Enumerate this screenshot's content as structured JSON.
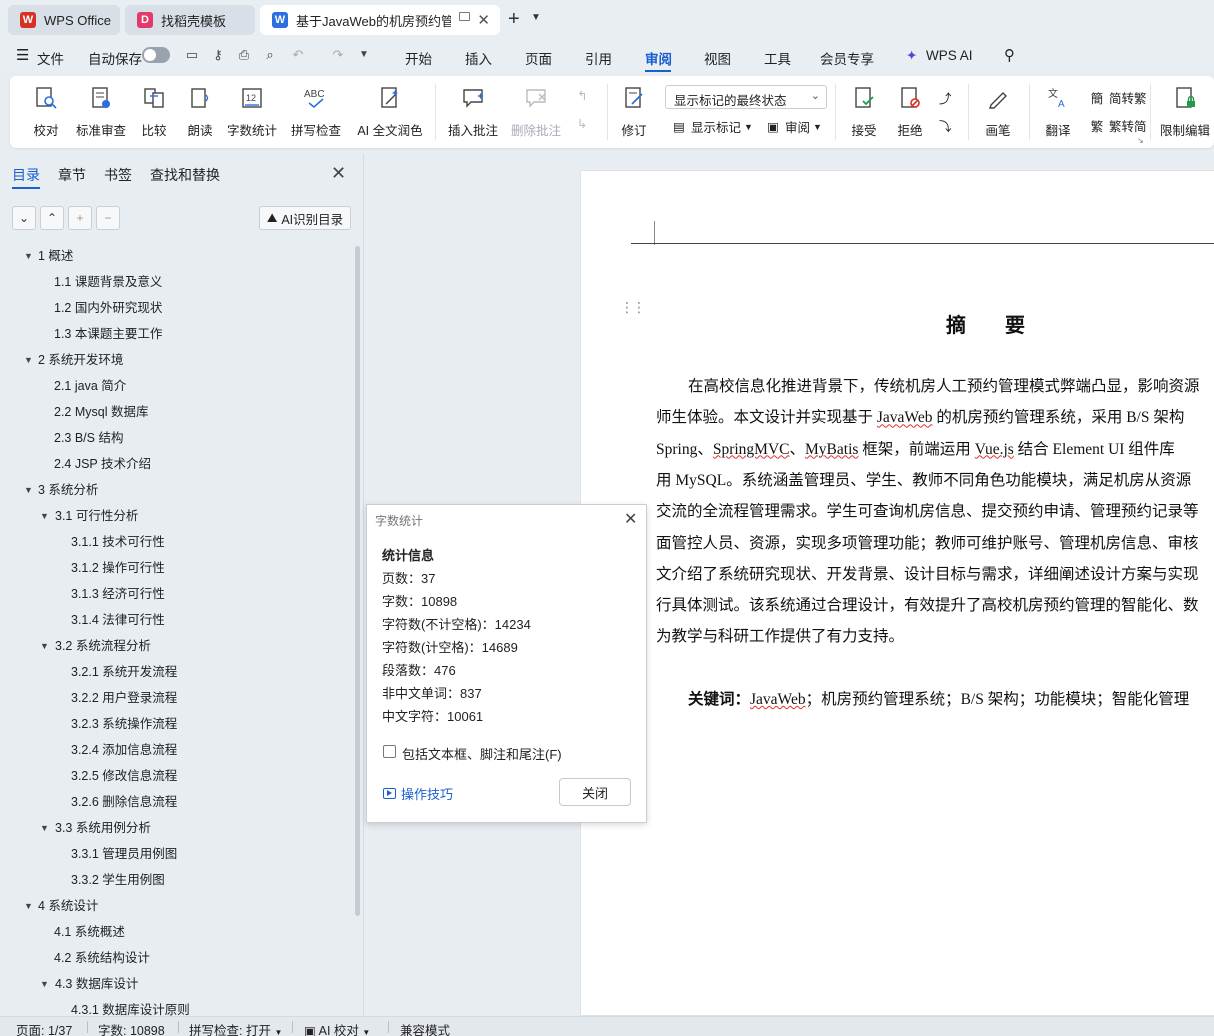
{
  "tabs": [
    {
      "label": "WPS Office",
      "icon": "wps-logo-icon"
    },
    {
      "label": "找稻壳模板",
      "icon": "docer-icon"
    },
    {
      "label": "基于JavaWeb的机房预约管理",
      "icon": "word-doc-icon"
    }
  ],
  "menubar": {
    "file": "文件",
    "autosave": "自动保存",
    "items": [
      "开始",
      "插入",
      "页面",
      "引用",
      "审阅",
      "视图",
      "工具",
      "会员专享"
    ],
    "active": "审阅",
    "wps_ai": "WPS AI"
  },
  "ribbon": {
    "proofread": "校对",
    "std_review": "标准审查",
    "compare": "比较",
    "read_aloud": "朗读",
    "word_count": "字数统计",
    "spell_check": "拼写检查",
    "ai_polish": "AI 全文润色",
    "insert_comment": "插入批注",
    "delete_comment": "删除批注",
    "track_changes": "修订",
    "show_markup_select": "显示标记的最终状态",
    "show_markup": "显示标记",
    "review": "审阅",
    "accept": "接受",
    "reject": "拒绝",
    "pen": "画笔",
    "translate": "翻译",
    "to_traditional": "简转繁",
    "to_simplified": "繁转简",
    "restrict_edit": "限制编辑"
  },
  "nav": {
    "tabs": [
      "目录",
      "章节",
      "书签",
      "查找和替换"
    ],
    "ai_button": "AI识别目录",
    "toc": [
      {
        "label": "1  概述",
        "level": 1,
        "expanded": true
      },
      {
        "label": "1.1 课题背景及意义",
        "level": 2
      },
      {
        "label": "1.2  国内外研究现状",
        "level": 2
      },
      {
        "label": "1.3  本课题主要工作",
        "level": 2
      },
      {
        "label": "2  系统开发环境",
        "level": 1,
        "expanded": true
      },
      {
        "label": "2.1 java 简介",
        "level": 2
      },
      {
        "label": "2.2 Mysql 数据库",
        "level": 2
      },
      {
        "label": "2.3 B/S 结构",
        "level": 2
      },
      {
        "label": "2.4 JSP 技术介绍",
        "level": 2
      },
      {
        "label": "3  系统分析",
        "level": 1,
        "expanded": true
      },
      {
        "label": "3.1  可行性分析",
        "level": 2,
        "expanded": true
      },
      {
        "label": "3.1.1  技术可行性",
        "level": 3
      },
      {
        "label": "3.1.2 操作可行性",
        "level": 3
      },
      {
        "label": "3.1.3  经济可行性",
        "level": 3
      },
      {
        "label": "3.1.4  法律可行性",
        "level": 3
      },
      {
        "label": "3.2 系统流程分析",
        "level": 2,
        "expanded": true
      },
      {
        "label": "3.2.1 系统开发流程",
        "level": 3
      },
      {
        "label": "3.2.2  用户登录流程",
        "level": 3
      },
      {
        "label": "3.2.3  系统操作流程",
        "level": 3
      },
      {
        "label": "3.2.4  添加信息流程",
        "level": 3
      },
      {
        "label": "3.2.5  修改信息流程",
        "level": 3
      },
      {
        "label": "3.2.6  删除信息流程",
        "level": 3
      },
      {
        "label": "3.3 系统用例分析",
        "level": 2,
        "expanded": true
      },
      {
        "label": "3.3.1 管理员用例图",
        "level": 3
      },
      {
        "label": "3.3.2 学生用例图",
        "level": 3
      },
      {
        "label": "4  系统设计",
        "level": 1,
        "expanded": true
      },
      {
        "label": "4.1  系统概述",
        "level": 2
      },
      {
        "label": "4.2  系统结构设计",
        "level": 2
      },
      {
        "label": "4.3 数据库设计",
        "level": 2,
        "expanded": true
      },
      {
        "label": "4.3.1  数据库设计原则",
        "level": 3
      }
    ]
  },
  "document": {
    "title": "摘 要",
    "lines": [
      "在高校信息化推进背景下，传统机房人工预约管理模式弊端凸显，影响资源",
      "师生体验。本文设计并实现基于 JavaWeb 的机房预约管理系统，采用 B/S 架构",
      "Spring、SpringMVC、MyBatis 框架，前端运用 Vue.js 结合 Element UI 组件库",
      "用 MySQL。系统涵盖管理员、学生、教师不同角色功能模块，满足机房从资源",
      "交流的全流程管理需求。学生可查询机房信息、提交预约申请、管理预约记录等",
      "面管控人员、资源，实现多项管理功能；教师可维护账号、管理机房信息、审核",
      "文介绍了系统研究现状、开发背景、设计目标与需求，详细阐述设计方案与实现",
      "行具体测试。该系统通过合理设计，有效提升了高校机房预约管理的智能化、数",
      "为教学与科研工作提供了有力支持。"
    ],
    "keywords_label": "关键词：",
    "keywords": "JavaWeb；机房预约管理系统；B/S 架构；功能模块；智能化管理"
  },
  "dialog": {
    "title": "字数统计",
    "heading": "统计信息",
    "rows": [
      "页数：37",
      "字数：10898",
      "字符数(不计空格)：14234",
      "字符数(计空格)：14689",
      "段落数：476",
      "非中文单词：837",
      "中文字符：10061"
    ],
    "checkbox": "包括文本框、脚注和尾注(F)",
    "checkbox_checked": false,
    "tips": "操作技巧",
    "close": "关闭"
  },
  "statusbar": {
    "page": "页面: 1/37",
    "words": "字数: 10898",
    "spell": "拼写检查: 打开",
    "ai_proof": "AI 校对",
    "compat": "兼容模式"
  },
  "colors": {
    "accent": "#1a5fd0",
    "wps_red": "#d93025"
  }
}
